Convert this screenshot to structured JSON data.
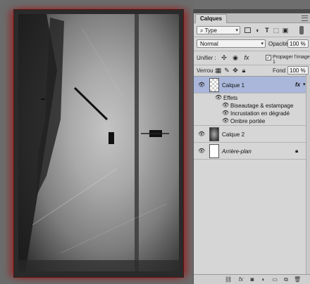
{
  "panel": {
    "tab_title": "Calques",
    "filter": {
      "label": "Type"
    },
    "blend_mode": "Normal",
    "opacity_label": "Opacité :",
    "opacity_value": "100 %",
    "unify_label": "Unifier :",
    "propagate_label": "Propager l'image 1",
    "lock_label": "Verrou :",
    "fill_label": "Fond :",
    "fill_value": "100 %",
    "layers": [
      {
        "name": "Calque 1",
        "selected": true,
        "fx": "fx",
        "effects_label": "Effets",
        "effects": [
          "Biseautage & estampage",
          "Incrustation en dégradé",
          "Ombre portée"
        ]
      },
      {
        "name": "Calque 2",
        "selected": false
      },
      {
        "name": "Arrière-plan",
        "selected": false,
        "locked": true
      }
    ]
  },
  "colors": {
    "selected_layer": "#aab7da",
    "panel_bg": "#d6d6d6",
    "canvas_bg": "#6c6c6c",
    "red_glow": "#aa0000"
  },
  "icons": {
    "filter": "search-icon",
    "bottom": [
      "link-icon",
      "fx-icon",
      "mask-icon",
      "adjustment-icon",
      "group-folder-icon",
      "new-layer-icon",
      "trash-icon"
    ]
  }
}
